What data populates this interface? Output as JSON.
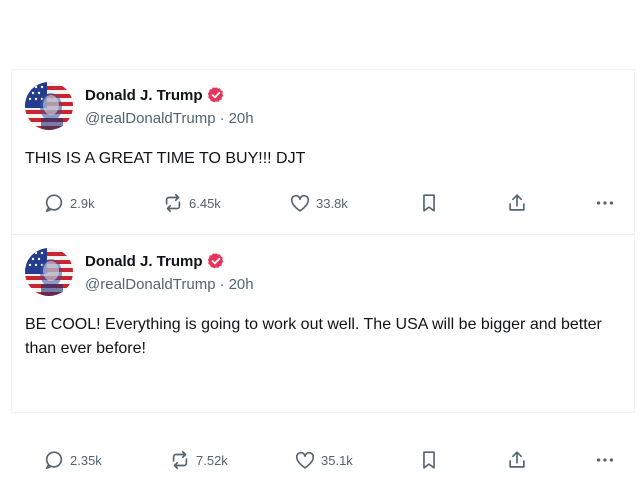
{
  "posts": [
    {
      "author": {
        "display_name": "Donald J. Trump",
        "handle": "@realDonaldTrump",
        "verified": true,
        "avatar": "flag-portrait-avatar"
      },
      "separator": "·",
      "time_ago": "20h",
      "text": "THIS IS A GREAT TIME TO BUY!!! DJT",
      "stats": {
        "replies": "2.9k",
        "reposts": "6.45k",
        "likes": "33.8k"
      }
    },
    {
      "author": {
        "display_name": "Donald J. Trump",
        "handle": "@realDonaldTrump",
        "verified": true,
        "avatar": "flag-portrait-avatar"
      },
      "separator": "·",
      "time_ago": "20h",
      "text": "BE COOL! Everything is going to work out well. The USA will be bigger and better than ever before!",
      "stats": {
        "replies": "2.35k",
        "reposts": "7.52k",
        "likes": "35.1k"
      }
    }
  ],
  "icons": {
    "reply": "comment-bubble-icon",
    "repost": "repost-arrows-icon",
    "like": "heart-icon",
    "bookmark": "bookmark-icon",
    "share": "share-upload-icon",
    "more": "more-dots-icon",
    "verified": "verified-badge-icon"
  },
  "colors": {
    "verified_badge": "#e8345a",
    "text_primary": "#0f1419",
    "text_secondary": "#536471",
    "divider": "#ececec"
  }
}
